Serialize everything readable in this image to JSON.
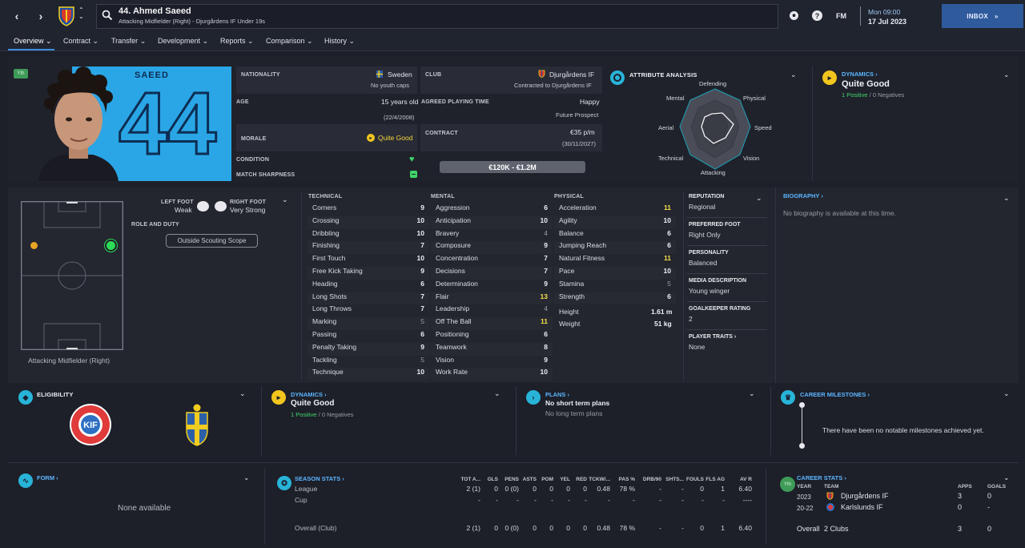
{
  "header": {
    "player_title": "44. Ahmed Saeed",
    "player_subtitle": "Attacking Midfielder (Right) - Djurgårdens IF Under 19s",
    "logo_text": "FM",
    "date_day": "Mon 09:00",
    "date": "17 Jul 2023",
    "inbox_label": "INBOX"
  },
  "tabs": [
    "Overview",
    "Contract",
    "Transfer",
    "Development",
    "Reports",
    "Comparison",
    "History"
  ],
  "profile": {
    "badge": "Yth",
    "shirt_name": "SAEED",
    "shirt_number": "44"
  },
  "details": {
    "nationality_label": "NATIONALITY",
    "nationality": "Sweden",
    "youth_caps": "No youth caps",
    "club_label": "CLUB",
    "club": "Djurgårdens IF",
    "club_contract": "Contracted to Djurgårdens IF",
    "age_label": "AGE",
    "age": "15 years old",
    "dob": "(22/4/2008)",
    "playing_time_label": "AGREED PLAYING TIME",
    "playing_time_status": "Happy",
    "playing_time": "Future Prospect",
    "morale_label": "MORALE",
    "morale": "Quite Good",
    "contract_label": "CONTRACT",
    "wage": "€35 p/m",
    "contract_end": "(30/11/2027)",
    "condition_label": "CONDITION",
    "sharpness_label": "MATCH SHARPNESS",
    "value_range": "€120K - €1.2M"
  },
  "attribute_analysis": {
    "title": "ATTRIBUTE ANALYSIS",
    "axes": [
      "Defending",
      "Physical",
      "Speed",
      "Vision",
      "Attacking",
      "Technical",
      "Aerial",
      "Mental"
    ]
  },
  "dynamics": {
    "title": "DYNAMICS",
    "value": "Quite Good",
    "positives": "1 Positive",
    "separator": "/",
    "negatives": "0 Negatives"
  },
  "pitch": {
    "left_foot_label": "LEFT FOOT",
    "left_foot": "Weak",
    "right_foot_label": "RIGHT FOOT",
    "right_foot": "Very Strong",
    "role_label": "ROLE AND DUTY",
    "scouting_button": "Outside Scouting Scope",
    "position": "Attacking Midfielder (Right)"
  },
  "technical": {
    "title": "TECHNICAL",
    "rows": [
      {
        "name": "Corners",
        "value": "9",
        "tone": ""
      },
      {
        "name": "Crossing",
        "value": "10",
        "tone": ""
      },
      {
        "name": "Dribbling",
        "value": "10",
        "tone": ""
      },
      {
        "name": "Finishing",
        "value": "7",
        "tone": ""
      },
      {
        "name": "First Touch",
        "value": "10",
        "tone": ""
      },
      {
        "name": "Free Kick Taking",
        "value": "9",
        "tone": ""
      },
      {
        "name": "Heading",
        "value": "6",
        "tone": ""
      },
      {
        "name": "Long Shots",
        "value": "7",
        "tone": ""
      },
      {
        "name": "Long Throws",
        "value": "7",
        "tone": ""
      },
      {
        "name": "Marking",
        "value": "5",
        "tone": "lo"
      },
      {
        "name": "Passing",
        "value": "6",
        "tone": ""
      },
      {
        "name": "Penalty Taking",
        "value": "9",
        "tone": ""
      },
      {
        "name": "Tackling",
        "value": "5",
        "tone": "lo"
      },
      {
        "name": "Technique",
        "value": "10",
        "tone": ""
      }
    ]
  },
  "mental": {
    "title": "MENTAL",
    "rows": [
      {
        "name": "Aggression",
        "value": "6",
        "tone": ""
      },
      {
        "name": "Anticipation",
        "value": "10",
        "tone": ""
      },
      {
        "name": "Bravery",
        "value": "4",
        "tone": "lo"
      },
      {
        "name": "Composure",
        "value": "9",
        "tone": ""
      },
      {
        "name": "Concentration",
        "value": "7",
        "tone": ""
      },
      {
        "name": "Decisions",
        "value": "7",
        "tone": ""
      },
      {
        "name": "Determination",
        "value": "9",
        "tone": ""
      },
      {
        "name": "Flair",
        "value": "13",
        "tone": "hi"
      },
      {
        "name": "Leadership",
        "value": "4",
        "tone": "lo"
      },
      {
        "name": "Off The Ball",
        "value": "11",
        "tone": "hi"
      },
      {
        "name": "Positioning",
        "value": "6",
        "tone": ""
      },
      {
        "name": "Teamwork",
        "value": "8",
        "tone": ""
      },
      {
        "name": "Vision",
        "value": "9",
        "tone": ""
      },
      {
        "name": "Work Rate",
        "value": "10",
        "tone": ""
      }
    ]
  },
  "physical": {
    "title": "PHYSICAL",
    "rows": [
      {
        "name": "Acceleration",
        "value": "11",
        "tone": "hi"
      },
      {
        "name": "Agility",
        "value": "10",
        "tone": ""
      },
      {
        "name": "Balance",
        "value": "6",
        "tone": ""
      },
      {
        "name": "Jumping Reach",
        "value": "6",
        "tone": ""
      },
      {
        "name": "Natural Fitness",
        "value": "11",
        "tone": "hi"
      },
      {
        "name": "Pace",
        "value": "10",
        "tone": ""
      },
      {
        "name": "Stamina",
        "value": "5",
        "tone": "lo"
      },
      {
        "name": "Strength",
        "value": "6",
        "tone": ""
      }
    ],
    "height_label": "Height",
    "height": "1.61 m",
    "weight_label": "Weight",
    "weight": "51 kg"
  },
  "info": {
    "reputation_label": "REPUTATION",
    "reputation": "Regional",
    "foot_label": "PREFERRED FOOT",
    "foot": "Right Only",
    "personality_label": "PERSONALITY",
    "personality": "Balanced",
    "media_label": "MEDIA DESCRIPTION",
    "media": "Young winger",
    "gk_label": "GOALKEEPER RATING",
    "gk": "2",
    "traits_label": "PLAYER TRAITS",
    "traits": "None"
  },
  "biography": {
    "title": "BIOGRAPHY",
    "text": "No biography is available at this time."
  },
  "eligibility": {
    "title": "ELIGIBILITY",
    "club_badge_text": "KARLSLUNDS IF HFK ÖREBRO"
  },
  "dynamics2": {
    "title": "DYNAMICS",
    "value": "Quite Good",
    "positives": "1 Positive",
    "separator": "/",
    "negatives": "0 Negatives"
  },
  "plans": {
    "title": "PLANS",
    "short": "No short term plans",
    "long": "No long term plans"
  },
  "milestones": {
    "title": "CAREER MILESTONES",
    "text": "There have been no notable milestones achieved yet."
  },
  "form": {
    "title": "FORM",
    "text": "None available"
  },
  "season_stats": {
    "title": "SEASON STATS",
    "columns": [
      "TOT A...",
      "GLS",
      "PENS",
      "ASTS",
      "POM",
      "YEL",
      "RED",
      "TCKW/...",
      "PAS %",
      "DRB/90",
      "SHTS...",
      "FOULS",
      "FLS AG",
      "AV R"
    ],
    "rows": [
      {
        "label": "League",
        "values": [
          "2 (1)",
          "0",
          "0 (0)",
          "0",
          "0",
          "0",
          "0",
          "0.48",
          "78 %",
          "-",
          "-",
          "0",
          "1",
          "6.40"
        ]
      },
      {
        "label": "Cup",
        "values": [
          "-",
          "-",
          "-",
          "-",
          "-",
          "-",
          "-",
          "-",
          "-",
          "-",
          "-",
          "-",
          "-",
          "----"
        ]
      },
      {
        "label": "Overall (Club)",
        "values": [
          "2 (1)",
          "0",
          "0 (0)",
          "0",
          "0",
          "0",
          "0",
          "0.48",
          "78 %",
          "-",
          "-",
          "0",
          "1",
          "6.40"
        ]
      }
    ]
  },
  "career_stats": {
    "title": "CAREER STATS",
    "badge": "Yth",
    "col_year": "YEAR",
    "col_team": "TEAM",
    "col_apps": "APPS",
    "col_goals": "GOALS",
    "rows": [
      {
        "year": "2023",
        "team": "Djurgårdens IF",
        "apps": "3",
        "goals": "0"
      },
      {
        "year": "20-22",
        "team": "Karlslunds IF",
        "apps": "0",
        "goals": "-"
      }
    ],
    "total_label": "Overall",
    "total_team": "2 Clubs",
    "total_apps": "3",
    "total_goals": "0"
  }
}
